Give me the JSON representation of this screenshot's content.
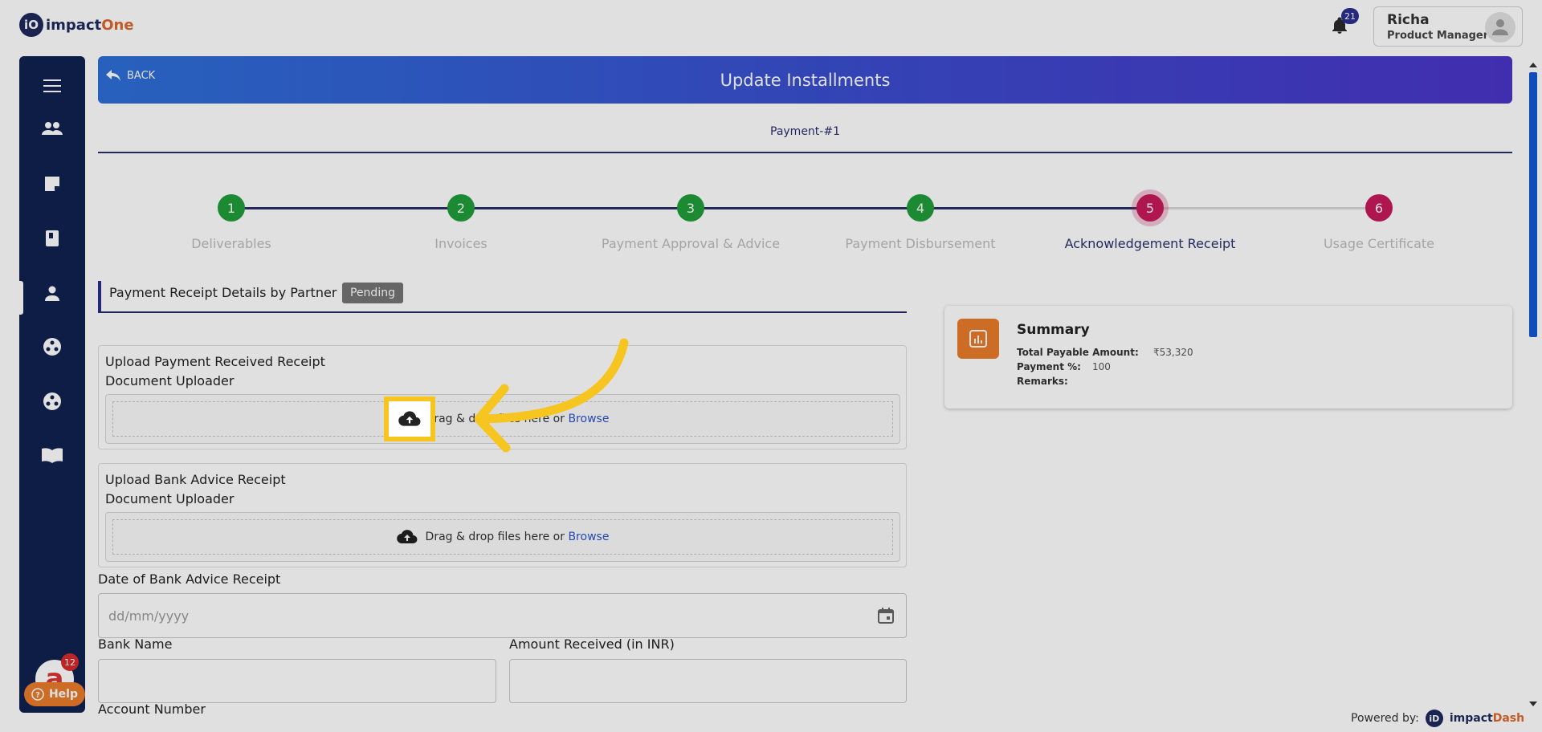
{
  "app": {
    "logo_badge": "iO",
    "logo_text_a": "impact",
    "logo_text_b": "One"
  },
  "header": {
    "notifications": "21",
    "user_name": "Richa",
    "user_role": "Product Manager"
  },
  "page": {
    "back_label": "BACK",
    "title": "Update Installments",
    "payment_label": "Payment-#1"
  },
  "steps": [
    {
      "num": "1",
      "label": "Deliverables",
      "state": "done"
    },
    {
      "num": "2",
      "label": "Invoices",
      "state": "done"
    },
    {
      "num": "3",
      "label": "Payment Approval & Advice",
      "state": "done"
    },
    {
      "num": "4",
      "label": "Payment Disbursement",
      "state": "done"
    },
    {
      "num": "5",
      "label": "Acknowledgement Receipt",
      "state": "active"
    },
    {
      "num": "6",
      "label": "Usage Certificate",
      "state": "todo"
    }
  ],
  "section": {
    "title": "Payment Receipt Details by Partner",
    "status": "Pending"
  },
  "uploads": [
    {
      "title": "Upload Payment Received Receipt",
      "sub": "Document Uploader",
      "drop_text": "Drag & drop files here or ",
      "browse": "Browse"
    },
    {
      "title": "Upload Bank Advice Receipt",
      "sub": "Document Uploader",
      "drop_text": "Drag & drop files here or ",
      "browse": "Browse"
    }
  ],
  "form": {
    "date_label": "Date of Bank Advice Receipt",
    "date_placeholder": "dd/mm/yyyy",
    "bank_label": "Bank Name",
    "amount_label": "Amount Received (in INR)",
    "account_label": "Account Number"
  },
  "summary": {
    "title": "Summary",
    "rows": [
      {
        "k": "Total Payable Amount:",
        "v": "₹53,320"
      },
      {
        "k": "Payment %:",
        "v": "100"
      },
      {
        "k": "Remarks:",
        "v": ""
      }
    ]
  },
  "widgets": {
    "ai_badge": "12",
    "help_label": "Help"
  },
  "footer": {
    "powered_label": "Powered by:",
    "brand_badge": "iD",
    "brand_a": "impact",
    "brand_b": "Dash"
  },
  "colors": {
    "primary": "#2a2f8f",
    "success": "#1f9e3a",
    "danger": "#c8195a",
    "accent": "#e97b2b",
    "highlight": "#f7c51f"
  }
}
